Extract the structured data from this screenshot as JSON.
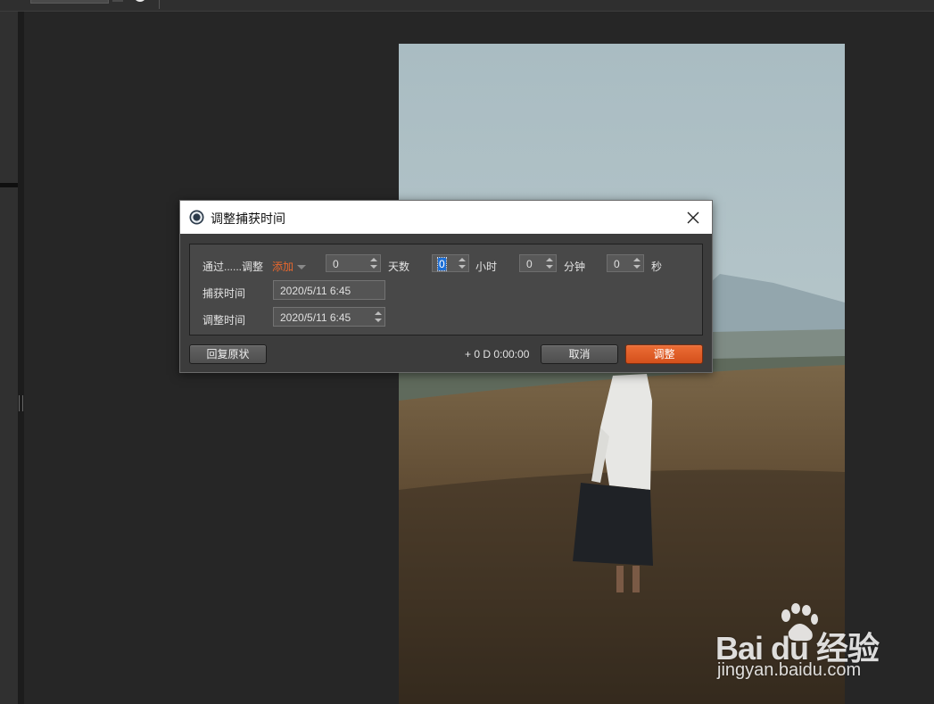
{
  "dialog": {
    "title": "调整捕获时间",
    "adjust_by_label": "通过......调整",
    "mode_value": "添加",
    "days": {
      "value": "0",
      "unit": "天数"
    },
    "hours": {
      "value": "0",
      "unit": "小时"
    },
    "minutes": {
      "value": "0",
      "unit": "分钟"
    },
    "seconds": {
      "value": "0",
      "unit": "秒"
    },
    "capture_time_label": "捕获时间",
    "capture_time_value": "2020/5/11 6:45",
    "adjusted_time_label": "调整时间",
    "adjusted_time_value": "2020/5/11 6:45",
    "reset_label": "回复原状",
    "offset_summary": "+ 0 D 0:00:00",
    "cancel_label": "取消",
    "adjust_label": "调整"
  },
  "watermark": {
    "brand": "Bai du 经验",
    "url": "jingyan.baidu.com"
  },
  "colors": {
    "accent": "#e8672d",
    "dialog_bg": "#3c3c3c",
    "app_bg": "#262626",
    "selection": "#1d6fd6"
  },
  "icons": [
    "app-logo-icon",
    "close-icon",
    "spin-up-icon",
    "spin-down-icon",
    "dropdown-caret-icon",
    "splitter-grip-icon"
  ]
}
